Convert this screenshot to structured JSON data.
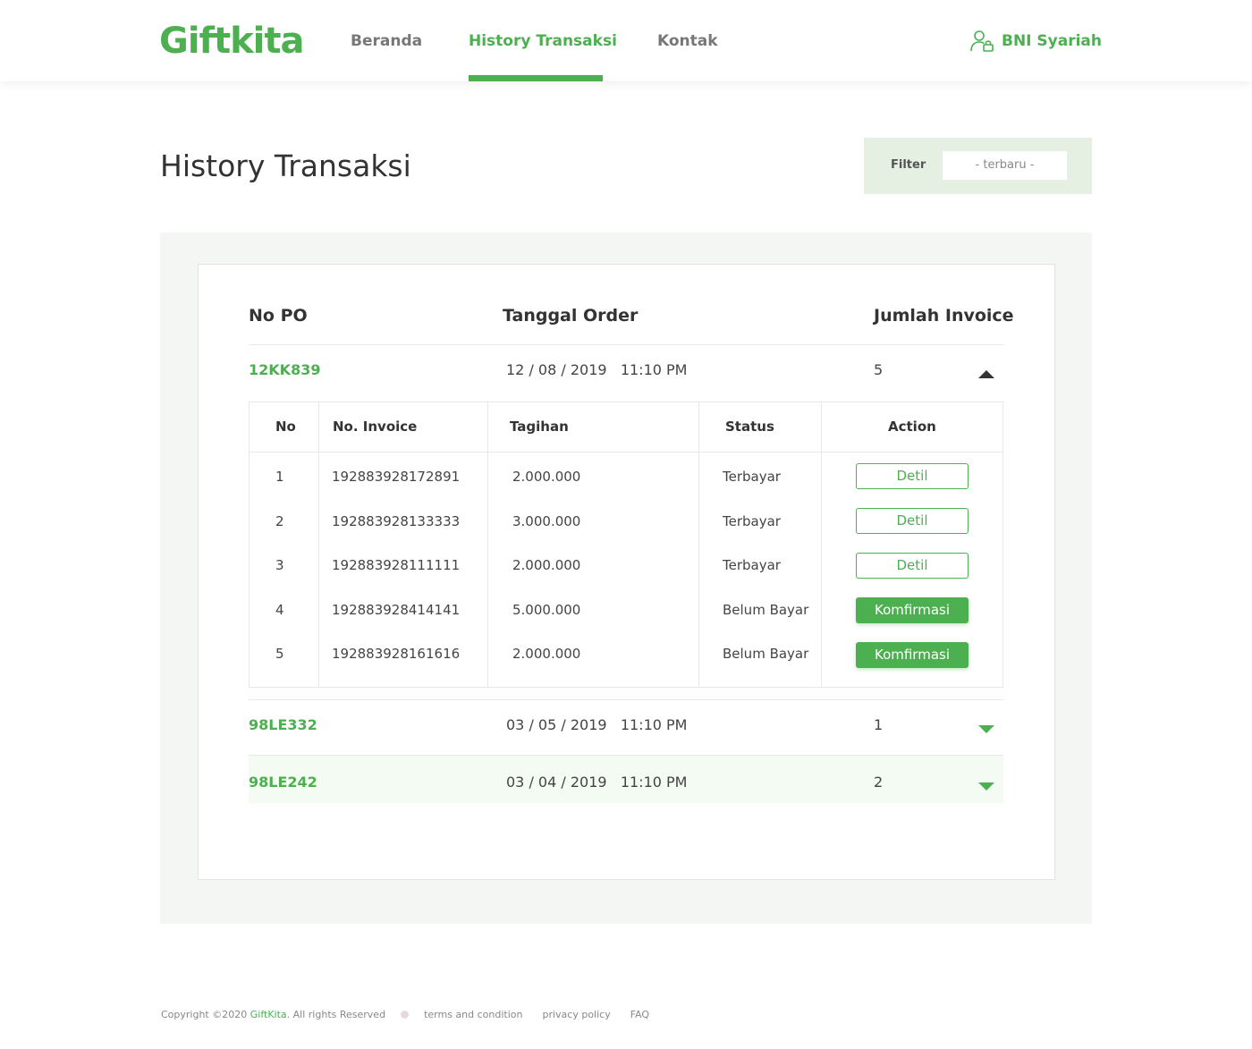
{
  "header": {
    "logo": "Giftkita",
    "nav": [
      {
        "label": "Beranda"
      },
      {
        "label": "History Transaksi"
      },
      {
        "label": "Kontak"
      }
    ],
    "user_name": "BNI Syariah",
    "user_icon": "user-lock-icon"
  },
  "page": {
    "title": "History Transaksi",
    "filter_label": "Filter",
    "filter_value": "- terbaru -"
  },
  "table": {
    "headers": {
      "po": "No PO",
      "date": "Tanggal Order",
      "count": "Jumlah Invoice"
    },
    "orders": [
      {
        "po": "12KK839",
        "date": "12 / 08 / 2019   11:10 PM",
        "count": "5",
        "expanded": true
      },
      {
        "po": "98LE332",
        "date": "03 / 05 / 2019   11:10 PM",
        "count": "1",
        "expanded": false
      },
      {
        "po": "98LE242",
        "date": "03 / 04 / 2019   11:10 PM",
        "count": "2",
        "expanded": false
      }
    ],
    "invoice_headers": {
      "no": "No",
      "invoice": "No. Invoice",
      "amount": "Tagihan",
      "status": "Status",
      "action": "Action"
    },
    "invoices": [
      {
        "no": "1",
        "invoice": "192883928172891",
        "amount": "2.000.000",
        "status": "Terbayar",
        "action": "Detil"
      },
      {
        "no": "2",
        "invoice": "192883928133333",
        "amount": "3.000.000",
        "status": "Terbayar",
        "action": "Detil"
      },
      {
        "no": "3",
        "invoice": "192883928111111",
        "amount": "2.000.000",
        "status": "Terbayar",
        "action": "Detil"
      },
      {
        "no": "4",
        "invoice": "192883928414141",
        "amount": "5.000.000",
        "status": "Belum Bayar",
        "action": "Komfirmasi"
      },
      {
        "no": "5",
        "invoice": "192883928161616",
        "amount": "2.000.000",
        "status": "Belum Bayar",
        "action": "Komfirmasi"
      }
    ]
  },
  "footer": {
    "copyright_prefix": "Copyright ©2020 ",
    "brand": "GiftKita",
    "copyright_suffix": ". All rights Reserved",
    "links": [
      "terms and condition",
      "privacy policy",
      "FAQ"
    ]
  },
  "colors": {
    "accent": "#4caf50",
    "panel": "#f3f6f2",
    "filter_bg": "#e5efe2"
  }
}
